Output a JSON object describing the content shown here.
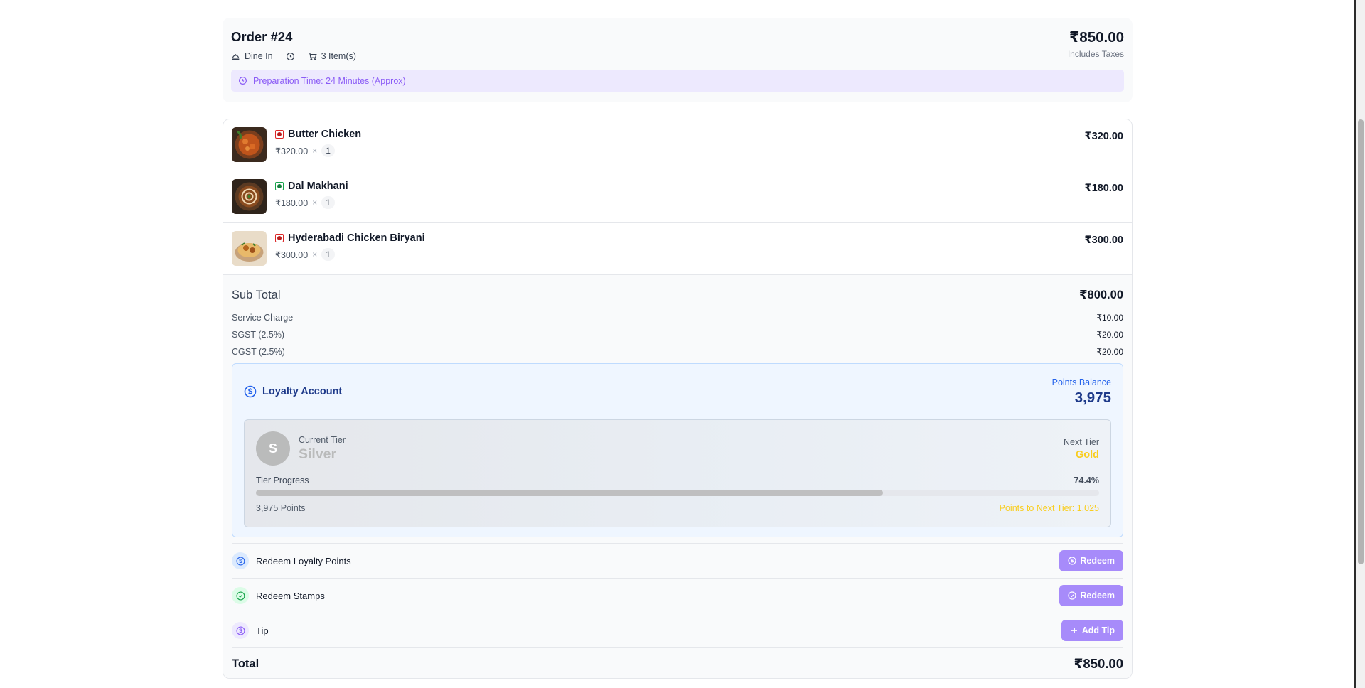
{
  "order": {
    "title": "Order #24",
    "dine_label": "Dine In",
    "items_label": "3 Item(s)",
    "total": "₹850.00",
    "total_note": "Includes Taxes",
    "prep_time": "Preparation Time: 24 Minutes (Approx)"
  },
  "items": [
    {
      "name": "Butter Chicken",
      "price": "₹320.00",
      "times": "×",
      "qty": "1",
      "total": "₹320.00",
      "type": "non-veg"
    },
    {
      "name": "Dal Makhani",
      "price": "₹180.00",
      "times": "×",
      "qty": "1",
      "total": "₹180.00",
      "type": "veg"
    },
    {
      "name": "Hyderabadi Chicken Biryani",
      "price": "₹300.00",
      "times": "×",
      "qty": "1",
      "total": "₹300.00",
      "type": "non-veg"
    }
  ],
  "summary": {
    "subtotal_label": "Sub Total",
    "subtotal": "₹800.00",
    "service_label": "Service Charge",
    "service": "₹10.00",
    "sgst_label": "SGST (2.5%)",
    "sgst": "₹20.00",
    "cgst_label": "CGST (2.5%)",
    "cgst": "₹20.00",
    "total_label": "Total",
    "total": "₹850.00"
  },
  "loyalty": {
    "title": "Loyalty Account",
    "balance_label": "Points Balance",
    "balance": "3,975",
    "avatar_letter": "S",
    "current_tier_label": "Current Tier",
    "current_tier": "Silver",
    "next_tier_label": "Next Tier",
    "next_tier": "Gold",
    "progress_label": "Tier Progress",
    "progress_text": "74.4%",
    "progress": 74.4,
    "points_text": "3,975 Points",
    "points_to_next": "Points to Next Tier: 1,025"
  },
  "actions": {
    "loyalty_label": "Redeem Loyalty Points",
    "loyalty_button": "Redeem",
    "stamps_label": "Redeem Stamps",
    "stamps_button": "Redeem",
    "tip_label": "Tip",
    "tip_button": "Add Tip"
  },
  "colors": {
    "accent": "#a78bfa",
    "prep_bg": "#ede9fe",
    "loyalty_bg": "#eff6ff",
    "gold": "#facc15",
    "silver": "#b8b8b8"
  }
}
